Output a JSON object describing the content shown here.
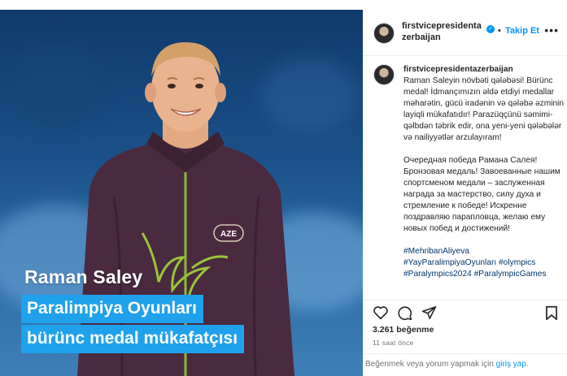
{
  "photo": {
    "name_caption": "Raman Saley",
    "title_line1": "Paralimpiya Oyunları",
    "title_line2": "bürünc medal mükafatçısı",
    "badge": "AZE"
  },
  "header": {
    "username": "firstvicepresidentazerbaijan",
    "separator": "•",
    "follow_label": "Takip Et",
    "more_label": "•••"
  },
  "caption": {
    "username": "firstvicepresidentazerbaijan",
    "az_text": "Raman Saleyin növbəti qələbəsi! Bürünc medal! İdmançımızın əldə etdiyi medallar məharətin, gücü iradənin və qələbə əzminin layiqli mükafatıdır! Parazüqçünü səmimi-qəlbdən təbrik edir, ona yeni-yeni qələbələr və nailiyyətlər arzulayıram!",
    "ru_text": "Очередная победа Рамана Салея! Бронзовая медаль! Завоеванные нашим спортсменом медали – заслуженная награда за мастерство, силу духа и стремление к победе! Искренне поздравляю параплoвца, желаю ему новых побед и достижений!",
    "hashtags": [
      "#MehribanAliyeva",
      "#YayParalimpiyaOyunları #olympics",
      "#Paralympics2024 #ParalympicGames"
    ]
  },
  "stats": {
    "likes": "3.261 beğenme",
    "time": "11 saat önce"
  },
  "comment_box": {
    "text": "Beğenmek veya yorum yapmak için",
    "link": "giriş yap",
    "end": "."
  },
  "icons": [
    "heart-icon",
    "comment-icon",
    "share-icon",
    "bookmark-icon",
    "verified-icon",
    "more-icon"
  ],
  "colors": {
    "accent": "#0095f6",
    "caption_box": "#1fa1ec",
    "jacket": "#4a2a3f",
    "hashtag": "#00376b"
  }
}
